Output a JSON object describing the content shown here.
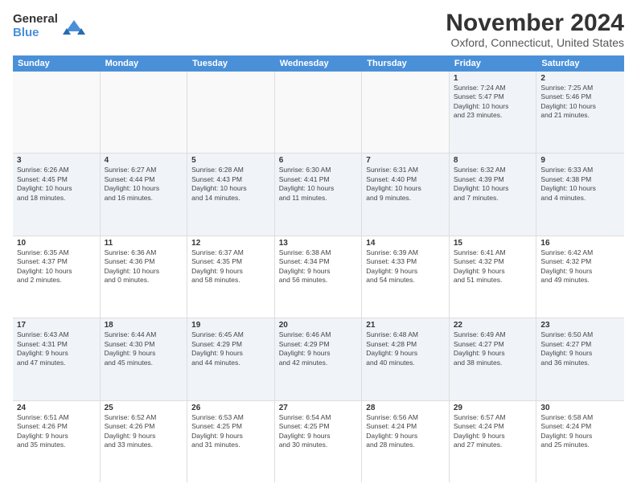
{
  "header": {
    "logo_general": "General",
    "logo_blue": "Blue",
    "month_title": "November 2024",
    "location": "Oxford, Connecticut, United States"
  },
  "calendar": {
    "days_of_week": [
      "Sunday",
      "Monday",
      "Tuesday",
      "Wednesday",
      "Thursday",
      "Friday",
      "Saturday"
    ],
    "weeks": [
      [
        {
          "day": "",
          "info": "",
          "empty": true
        },
        {
          "day": "",
          "info": "",
          "empty": true
        },
        {
          "day": "",
          "info": "",
          "empty": true
        },
        {
          "day": "",
          "info": "",
          "empty": true
        },
        {
          "day": "",
          "info": "",
          "empty": true
        },
        {
          "day": "1",
          "info": "Sunrise: 7:24 AM\nSunset: 5:47 PM\nDaylight: 10 hours\nand 23 minutes.",
          "empty": false
        },
        {
          "day": "2",
          "info": "Sunrise: 7:25 AM\nSunset: 5:46 PM\nDaylight: 10 hours\nand 21 minutes.",
          "empty": false
        }
      ],
      [
        {
          "day": "3",
          "info": "Sunrise: 6:26 AM\nSunset: 4:45 PM\nDaylight: 10 hours\nand 18 minutes.",
          "empty": false
        },
        {
          "day": "4",
          "info": "Sunrise: 6:27 AM\nSunset: 4:44 PM\nDaylight: 10 hours\nand 16 minutes.",
          "empty": false
        },
        {
          "day": "5",
          "info": "Sunrise: 6:28 AM\nSunset: 4:43 PM\nDaylight: 10 hours\nand 14 minutes.",
          "empty": false
        },
        {
          "day": "6",
          "info": "Sunrise: 6:30 AM\nSunset: 4:41 PM\nDaylight: 10 hours\nand 11 minutes.",
          "empty": false
        },
        {
          "day": "7",
          "info": "Sunrise: 6:31 AM\nSunset: 4:40 PM\nDaylight: 10 hours\nand 9 minutes.",
          "empty": false
        },
        {
          "day": "8",
          "info": "Sunrise: 6:32 AM\nSunset: 4:39 PM\nDaylight: 10 hours\nand 7 minutes.",
          "empty": false
        },
        {
          "day": "9",
          "info": "Sunrise: 6:33 AM\nSunset: 4:38 PM\nDaylight: 10 hours\nand 4 minutes.",
          "empty": false
        }
      ],
      [
        {
          "day": "10",
          "info": "Sunrise: 6:35 AM\nSunset: 4:37 PM\nDaylight: 10 hours\nand 2 minutes.",
          "empty": false
        },
        {
          "day": "11",
          "info": "Sunrise: 6:36 AM\nSunset: 4:36 PM\nDaylight: 10 hours\nand 0 minutes.",
          "empty": false
        },
        {
          "day": "12",
          "info": "Sunrise: 6:37 AM\nSunset: 4:35 PM\nDaylight: 9 hours\nand 58 minutes.",
          "empty": false
        },
        {
          "day": "13",
          "info": "Sunrise: 6:38 AM\nSunset: 4:34 PM\nDaylight: 9 hours\nand 56 minutes.",
          "empty": false
        },
        {
          "day": "14",
          "info": "Sunrise: 6:39 AM\nSunset: 4:33 PM\nDaylight: 9 hours\nand 54 minutes.",
          "empty": false
        },
        {
          "day": "15",
          "info": "Sunrise: 6:41 AM\nSunset: 4:32 PM\nDaylight: 9 hours\nand 51 minutes.",
          "empty": false
        },
        {
          "day": "16",
          "info": "Sunrise: 6:42 AM\nSunset: 4:32 PM\nDaylight: 9 hours\nand 49 minutes.",
          "empty": false
        }
      ],
      [
        {
          "day": "17",
          "info": "Sunrise: 6:43 AM\nSunset: 4:31 PM\nDaylight: 9 hours\nand 47 minutes.",
          "empty": false
        },
        {
          "day": "18",
          "info": "Sunrise: 6:44 AM\nSunset: 4:30 PM\nDaylight: 9 hours\nand 45 minutes.",
          "empty": false
        },
        {
          "day": "19",
          "info": "Sunrise: 6:45 AM\nSunset: 4:29 PM\nDaylight: 9 hours\nand 44 minutes.",
          "empty": false
        },
        {
          "day": "20",
          "info": "Sunrise: 6:46 AM\nSunset: 4:29 PM\nDaylight: 9 hours\nand 42 minutes.",
          "empty": false
        },
        {
          "day": "21",
          "info": "Sunrise: 6:48 AM\nSunset: 4:28 PM\nDaylight: 9 hours\nand 40 minutes.",
          "empty": false
        },
        {
          "day": "22",
          "info": "Sunrise: 6:49 AM\nSunset: 4:27 PM\nDaylight: 9 hours\nand 38 minutes.",
          "empty": false
        },
        {
          "day": "23",
          "info": "Sunrise: 6:50 AM\nSunset: 4:27 PM\nDaylight: 9 hours\nand 36 minutes.",
          "empty": false
        }
      ],
      [
        {
          "day": "24",
          "info": "Sunrise: 6:51 AM\nSunset: 4:26 PM\nDaylight: 9 hours\nand 35 minutes.",
          "empty": false
        },
        {
          "day": "25",
          "info": "Sunrise: 6:52 AM\nSunset: 4:26 PM\nDaylight: 9 hours\nand 33 minutes.",
          "empty": false
        },
        {
          "day": "26",
          "info": "Sunrise: 6:53 AM\nSunset: 4:25 PM\nDaylight: 9 hours\nand 31 minutes.",
          "empty": false
        },
        {
          "day": "27",
          "info": "Sunrise: 6:54 AM\nSunset: 4:25 PM\nDaylight: 9 hours\nand 30 minutes.",
          "empty": false
        },
        {
          "day": "28",
          "info": "Sunrise: 6:56 AM\nSunset: 4:24 PM\nDaylight: 9 hours\nand 28 minutes.",
          "empty": false
        },
        {
          "day": "29",
          "info": "Sunrise: 6:57 AM\nSunset: 4:24 PM\nDaylight: 9 hours\nand 27 minutes.",
          "empty": false
        },
        {
          "day": "30",
          "info": "Sunrise: 6:58 AM\nSunset: 4:24 PM\nDaylight: 9 hours\nand 25 minutes.",
          "empty": false
        }
      ]
    ]
  }
}
